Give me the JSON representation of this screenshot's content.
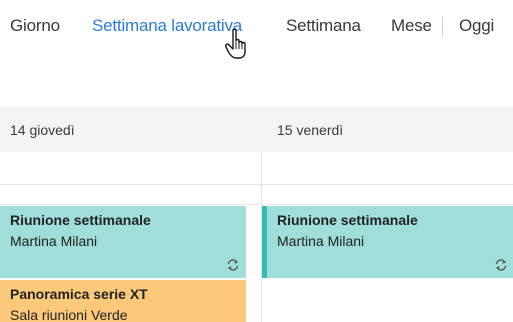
{
  "toolbar": {
    "views": [
      {
        "label": "Giorno"
      },
      {
        "label": "Settimana lavorativa",
        "active": true
      },
      {
        "label": "Settimana"
      },
      {
        "label": "Mese"
      }
    ],
    "today_label": "Oggi"
  },
  "days": [
    {
      "label": "14 giovedì"
    },
    {
      "label": "15 venerdì"
    }
  ],
  "events": [
    {
      "title": "Riunione settimanale",
      "subtitle": "Martina Milani",
      "color": "#9fded9",
      "recurring_icon": "recurring-icon"
    },
    {
      "title": "Riunione settimanale",
      "subtitle": "Martina Milani",
      "color": "#9fded9",
      "recurring_icon": "recurring-icon"
    },
    {
      "title": "Panoramica serie XT",
      "subtitle": "Sala riunioni Verde",
      "color": "#fcc879"
    }
  ],
  "colors": {
    "accent": "#2b7bd6",
    "teal_event": "#9fded9",
    "teal_bar": "#2fbfb3",
    "orange_event": "#fcc879"
  }
}
